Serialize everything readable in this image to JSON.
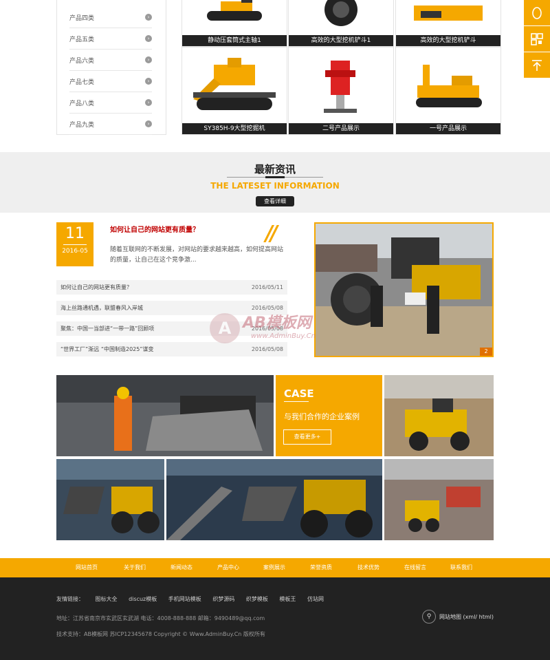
{
  "sidebar": {
    "items": [
      {
        "label": "产品四类"
      },
      {
        "label": "产品五类"
      },
      {
        "label": "产品六类"
      },
      {
        "label": "产品七类"
      },
      {
        "label": "产品八类"
      },
      {
        "label": "产品九类"
      }
    ]
  },
  "products": {
    "row1": [
      {
        "caption": "静动压套筒式主轴1"
      },
      {
        "caption": "高效的大型挖机铲斗1"
      },
      {
        "caption": "高效的大型挖机铲斗"
      }
    ],
    "row2": [
      {
        "caption": "SY385H-9大型挖掘机"
      },
      {
        "caption": "二号产品展示"
      },
      {
        "caption": "一号产品展示"
      }
    ]
  },
  "tools": {
    "icons": [
      "qq-icon",
      "qrcode-icon",
      "back-to-top-icon"
    ]
  },
  "news": {
    "title_cn": "最新资讯",
    "title_en": "THE LATESET INFORMATION",
    "more_label": "查看详细",
    "featured": {
      "day": "11",
      "year_month": "2016-05",
      "title": "如何让自己的网站更有质量？",
      "desc": "随着互联网的不断发展，对网站的要求越来越高，如何提高网站的质量，让自己在这个竞争激..."
    },
    "list": [
      {
        "title": "如何让自己的网站更有质量？",
        "date": "2016/05/11"
      },
      {
        "title": "海上丝路通机遇，联盟春风入岸城",
        "date": "2016/05/08"
      },
      {
        "title": "聚焦：中国一当部进“一带一路”回顾项",
        "date": "2016/05/08"
      },
      {
        "title": "“世界工厂”渐远 “中国制造2025”谋变",
        "date": "2016/05/08"
      }
    ],
    "photo_index": "2"
  },
  "watermark": {
    "brand": "AB模板网",
    "url": "www.AdminBuy.Cn",
    "logo_letter": "A"
  },
  "cases": {
    "title": "CASE",
    "subtitle": "与我们合作的企业案例",
    "more_label": "查看更多+"
  },
  "footnav": {
    "items": [
      "网站首页",
      "关于我们",
      "新闻动态",
      "产品中心",
      "案例展示",
      "荣誉资质",
      "技术优势",
      "在线留言",
      "联系我们"
    ]
  },
  "footer": {
    "links_label": "友情链接：",
    "links": [
      "图标大全",
      "discuz模板",
      "手机网站模板",
      "织梦源码",
      "织梦模板",
      "模板王",
      "仿站网"
    ],
    "address": "地址：江苏省南京市玄武区玄武湖  电话：4008-888-888  邮箱：9490489@qq.com",
    "copyright": "技术支持：AB模板网  苏ICP12345678  Copyright © Www.AdminBuy.Cn 版权所有",
    "sitemap_label": "网站地图",
    "sitemap_sub": "(xml/ html)"
  },
  "colors": {
    "accent": "#f5a800",
    "dark": "#222222"
  }
}
